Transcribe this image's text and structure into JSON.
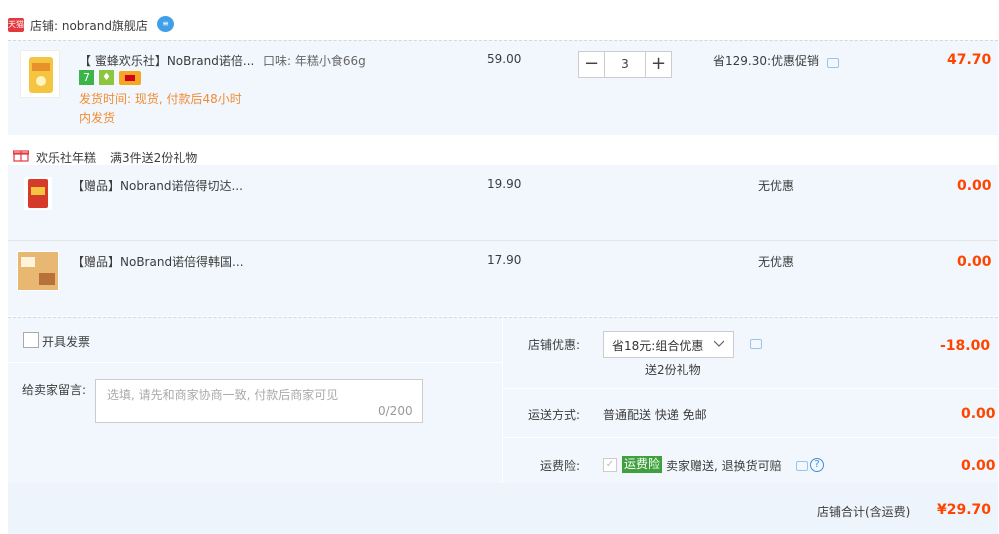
{
  "shop": {
    "badge": "天猫",
    "name": "店铺: nobrand旗舰店"
  },
  "main_item": {
    "title": "【 蜜蜂欢乐社】NoBrand诺倍...",
    "spec": "口味: 年糕小食66g",
    "unit_price": "59.00",
    "quantity": "3",
    "promo": "省129.30:优惠促销",
    "subtotal": "47.70",
    "shipping_line1": "发货时间: 现货, 付款后48小时",
    "shipping_line2": "内发货",
    "qty_minus": "−",
    "qty_plus": "+"
  },
  "gift_group": {
    "name": "欢乐社年糕",
    "rule": "满3件送2份礼物"
  },
  "gifts": [
    {
      "title": "【赠品】Nobrand诺倍得切达...",
      "price": "19.90",
      "promo": "无优惠",
      "subtotal": "0.00"
    },
    {
      "title": "【赠品】NoBrand诺倍得韩国...",
      "price": "17.90",
      "promo": "无优惠",
      "subtotal": "0.00"
    }
  ],
  "order": {
    "invoice_label": "开具发票",
    "message_label": "给卖家留言:",
    "message_placeholder": "选填, 请先和商家协商一致, 付款后商家可见",
    "message_counter": "0/200",
    "shop_discount_label": "店铺优惠:",
    "shop_discount_value": "省18元:组合优惠",
    "shop_discount_note": "送2份礼物",
    "shop_discount_amount": "-18.00",
    "delivery_label": "运送方式:",
    "delivery_value": "普通配送 快递 免邮",
    "delivery_amount": "0.00",
    "insurance_label": "运费险:",
    "insurance_tag": "运费险",
    "insurance_text": "卖家赠送, 退换货可赔",
    "insurance_amount": "0.00",
    "total_label": "店铺合计(含运费)",
    "total_amount": "¥29.70"
  },
  "colors": {
    "accent_red": "#ff4400",
    "panel_bg": "#f2f7fd",
    "orange_text": "#f08c34",
    "insurance_green": "#3ea13e"
  }
}
